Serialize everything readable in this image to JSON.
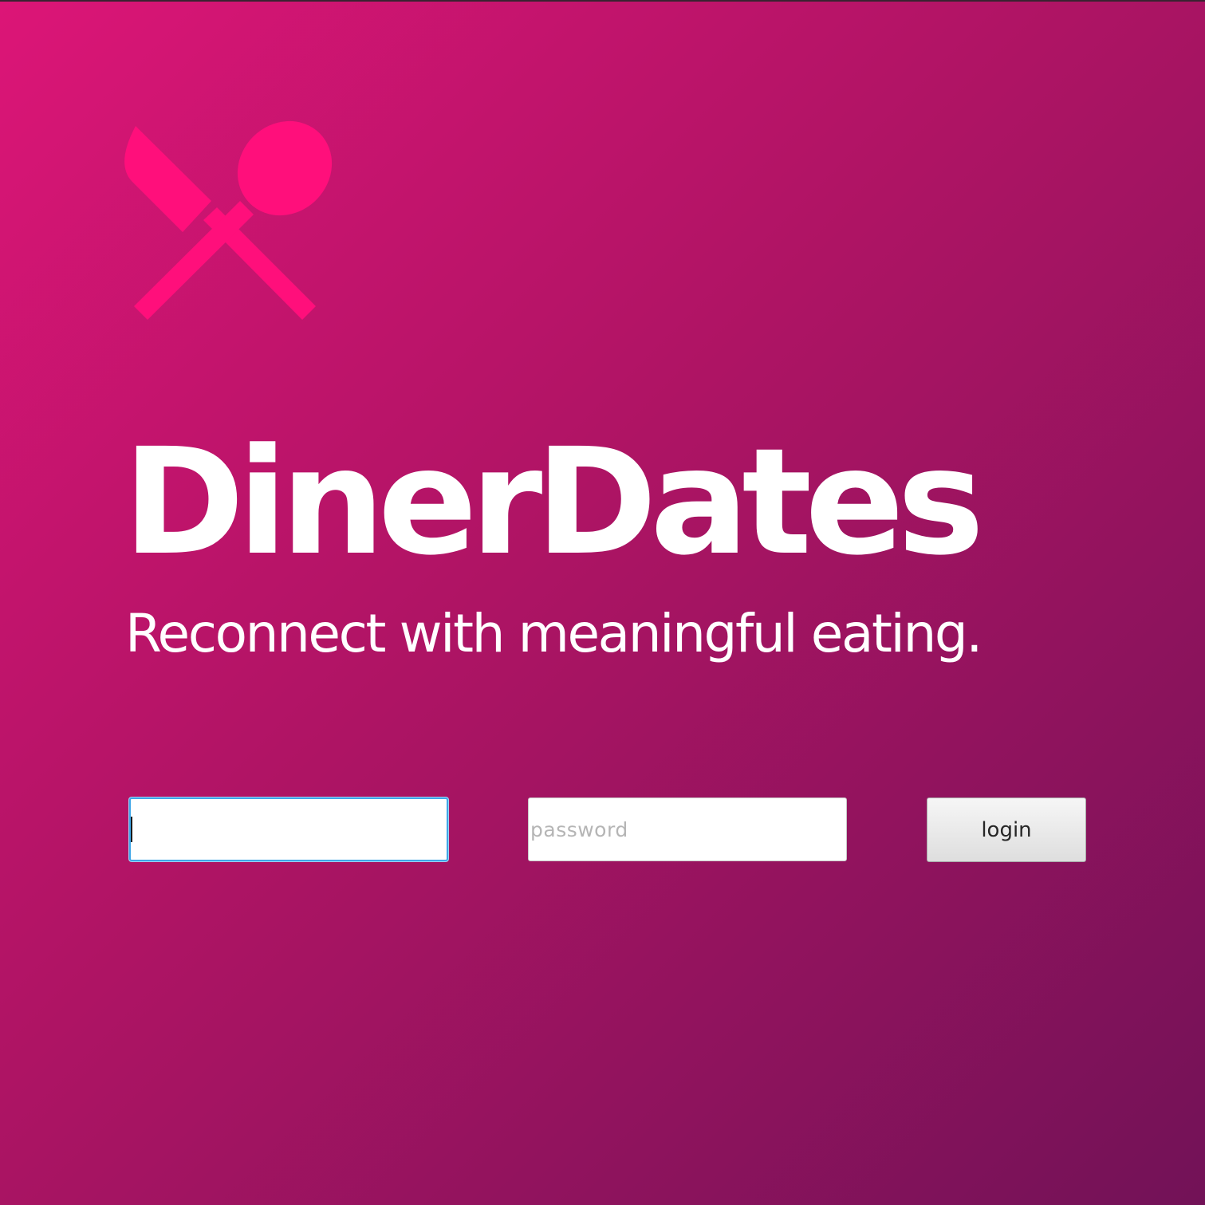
{
  "app": {
    "title": "DinerDates",
    "tagline": "Reconnect with meaningful eating.",
    "logo_icon": "fork-spoon-crossed-icon",
    "logo_color": "#ff0f7b",
    "background_gradient": [
      "#dc1577",
      "#ae1464",
      "#721257"
    ]
  },
  "login_form": {
    "username": {
      "value": "",
      "placeholder": "",
      "focused": true,
      "focus_color": "#3fa6e8"
    },
    "password": {
      "value": "",
      "placeholder": "password"
    },
    "login_button_label": "login"
  }
}
